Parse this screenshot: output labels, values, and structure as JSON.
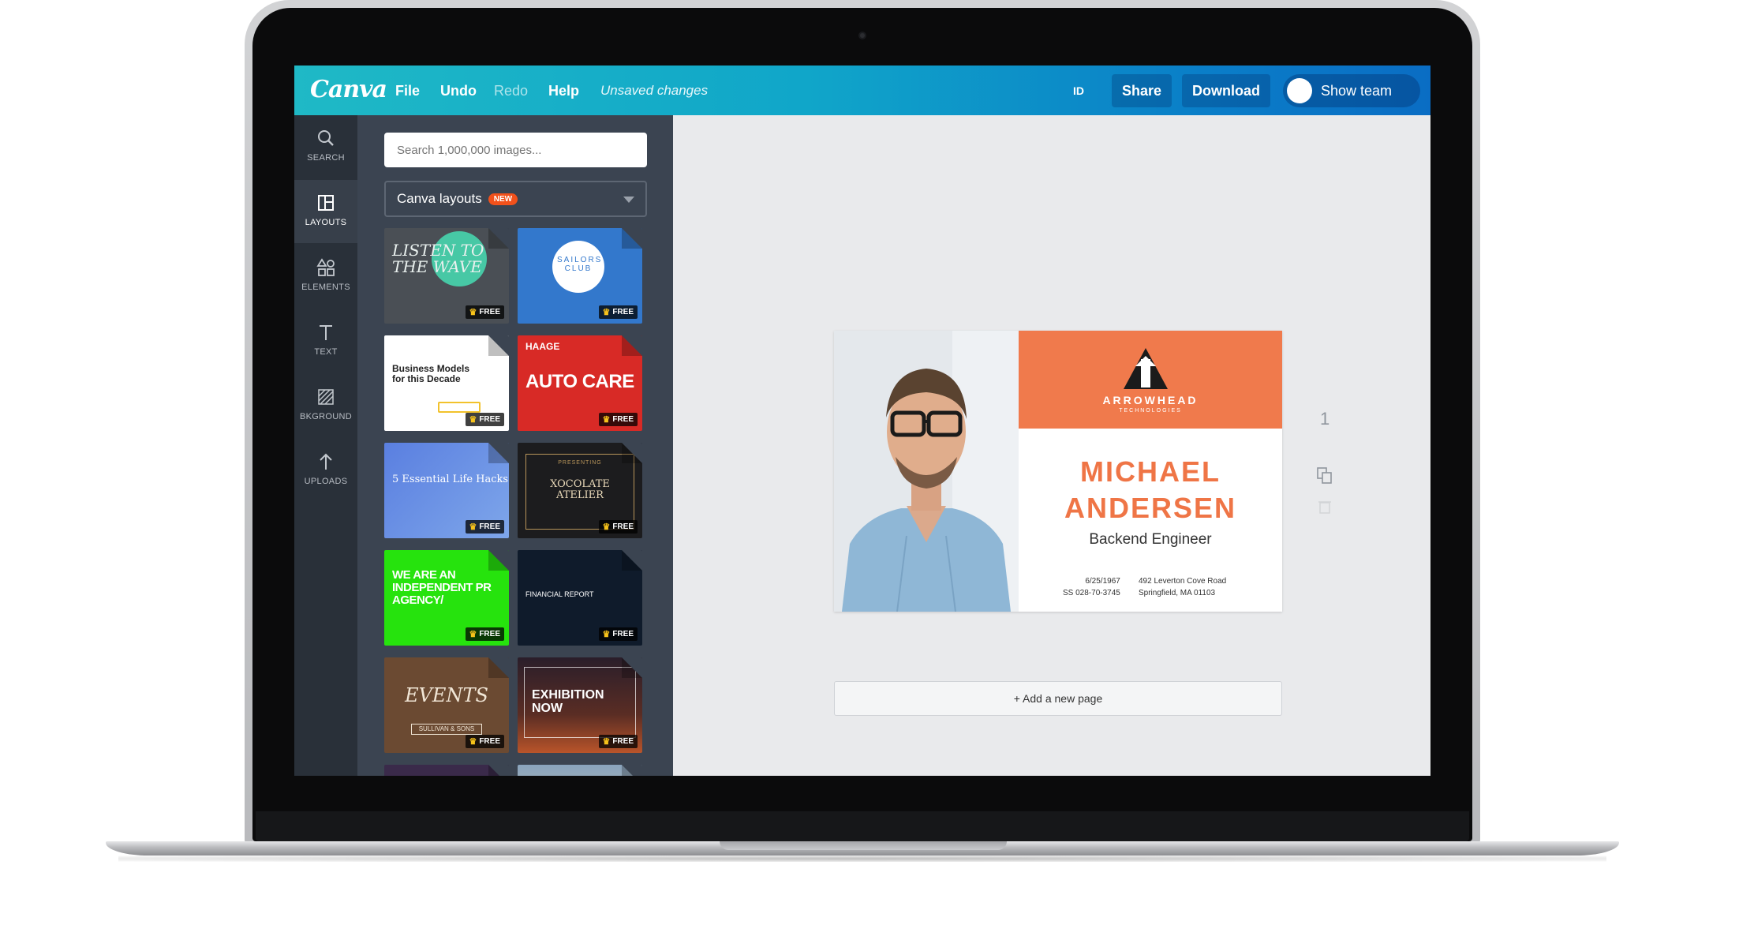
{
  "topbar": {
    "logo": "Canva",
    "menu": {
      "file": "File",
      "undo": "Undo",
      "redo": "Redo",
      "help": "Help"
    },
    "status": "Unsaved changes",
    "id_label": "ID",
    "share": "Share",
    "download": "Download",
    "show_team": "Show team"
  },
  "rail": {
    "search": "SEARCH",
    "layouts": "LAYOUTS",
    "elements": "ELEMENTS",
    "text": "TEXT",
    "background": "BKGROUND",
    "uploads": "UPLOADS"
  },
  "panel": {
    "search_placeholder": "Search 1,000,000 images...",
    "dropdown_label": "Canva layouts",
    "dropdown_badge": "NEW",
    "free_label": "FREE",
    "templates": [
      {
        "title": "LISTEN TO THE WAVE"
      },
      {
        "title": "SAILORS CLUB"
      },
      {
        "title": "Business Models for this Decade"
      },
      {
        "title": "AUTO CARE",
        "subtitle": "HAAGE"
      },
      {
        "title": "5 Essential Life Hacks"
      },
      {
        "title": "XOCOLATE ATELIER",
        "subtitle": "PRESENTING"
      },
      {
        "title": "WE ARE AN INDEPENDENT PR AGENCY/"
      },
      {
        "title": "FINANCIAL REPORT"
      },
      {
        "title": "EVENTS",
        "subtitle": "SULLIVAN & SONS"
      },
      {
        "title": "EXHIBITION NOW"
      }
    ]
  },
  "card": {
    "company": "ARROWHEAD",
    "company_sub": "TECHNOLOGIES",
    "first_name": "MICHAEL",
    "last_name": "ANDERSEN",
    "role": "Backend Engineer",
    "dob": "6/25/1967",
    "ss": "SS 028-70-3745",
    "address1": "492 Leverton Cove Road",
    "address2": "Springfield, MA 01103"
  },
  "canvas": {
    "page_number": "1",
    "add_page": "+ Add a new page"
  },
  "colors": {
    "accent_orange": "#f07a4c",
    "topbar_start": "#1fb9c6",
    "topbar_end": "#0a6dc4",
    "panel_bg": "#3b4451",
    "rail_bg": "#293039"
  }
}
